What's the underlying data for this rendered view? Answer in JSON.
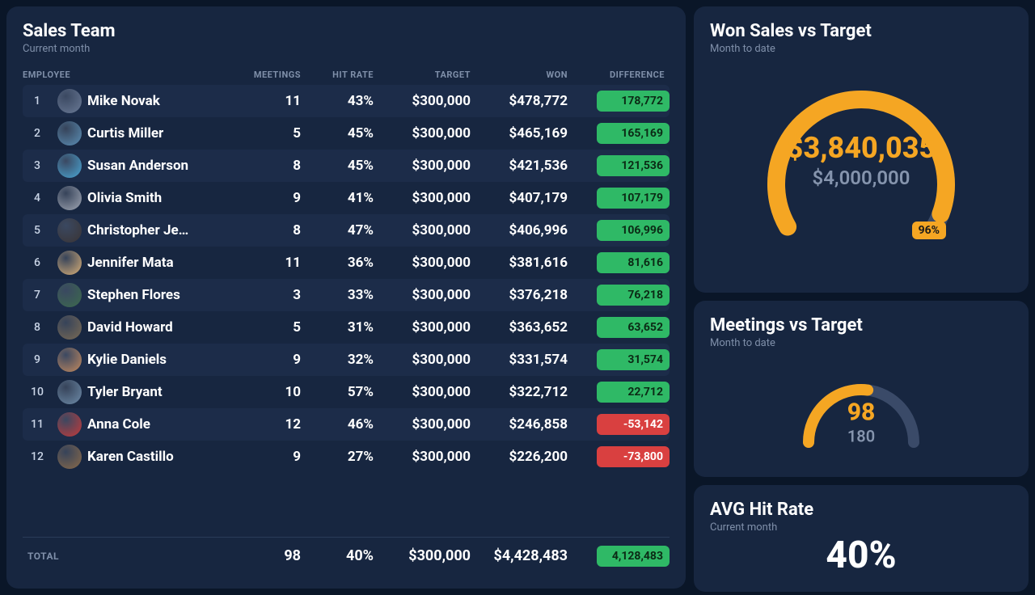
{
  "salesTeam": {
    "title": "Sales Team",
    "subtitle": "Current month",
    "columns": {
      "employee": "EMPLOYEE",
      "meetings": "MEETINGS",
      "hitrate": "HIT RATE",
      "target": "TARGET",
      "won": "WON",
      "difference": "DIFFERENCE"
    },
    "rows": [
      {
        "rank": "1",
        "name": "Mike Novak",
        "meetings": "11",
        "hitrate": "43%",
        "target": "$300,000",
        "won": "$478,772",
        "diff": "178,772",
        "diffSign": "pos"
      },
      {
        "rank": "2",
        "name": "Curtis Miller",
        "meetings": "5",
        "hitrate": "45%",
        "target": "$300,000",
        "won": "$465,169",
        "diff": "165,169",
        "diffSign": "pos"
      },
      {
        "rank": "3",
        "name": "Susan Anderson",
        "meetings": "8",
        "hitrate": "45%",
        "target": "$300,000",
        "won": "$421,536",
        "diff": "121,536",
        "diffSign": "pos"
      },
      {
        "rank": "4",
        "name": "Olivia Smith",
        "meetings": "9",
        "hitrate": "41%",
        "target": "$300,000",
        "won": "$407,179",
        "diff": "107,179",
        "diffSign": "pos"
      },
      {
        "rank": "5",
        "name": "Christopher Je…",
        "meetings": "8",
        "hitrate": "47%",
        "target": "$300,000",
        "won": "$406,996",
        "diff": "106,996",
        "diffSign": "pos"
      },
      {
        "rank": "6",
        "name": "Jennifer Mata",
        "meetings": "11",
        "hitrate": "36%",
        "target": "$300,000",
        "won": "$381,616",
        "diff": "81,616",
        "diffSign": "pos"
      },
      {
        "rank": "7",
        "name": "Stephen Flores",
        "meetings": "3",
        "hitrate": "33%",
        "target": "$300,000",
        "won": "$376,218",
        "diff": "76,218",
        "diffSign": "pos"
      },
      {
        "rank": "8",
        "name": "David Howard",
        "meetings": "5",
        "hitrate": "31%",
        "target": "$300,000",
        "won": "$363,652",
        "diff": "63,652",
        "diffSign": "pos"
      },
      {
        "rank": "9",
        "name": "Kylie Daniels",
        "meetings": "9",
        "hitrate": "32%",
        "target": "$300,000",
        "won": "$331,574",
        "diff": "31,574",
        "diffSign": "pos"
      },
      {
        "rank": "10",
        "name": "Tyler Bryant",
        "meetings": "10",
        "hitrate": "57%",
        "target": "$300,000",
        "won": "$322,712",
        "diff": "22,712",
        "diffSign": "pos"
      },
      {
        "rank": "11",
        "name": "Anna Cole",
        "meetings": "12",
        "hitrate": "46%",
        "target": "$300,000",
        "won": "$246,858",
        "diff": "-53,142",
        "diffSign": "neg"
      },
      {
        "rank": "12",
        "name": "Karen Castillo",
        "meetings": "9",
        "hitrate": "27%",
        "target": "$300,000",
        "won": "$226,200",
        "diff": "-73,800",
        "diffSign": "neg"
      }
    ],
    "total": {
      "label": "TOTAL",
      "meetings": "98",
      "hitrate": "40%",
      "target": "$300,000",
      "won": "$4,428,483",
      "diff": "4,128,483",
      "diffSign": "pos"
    }
  },
  "wonVsTarget": {
    "title": "Won Sales vs Target",
    "subtitle": "Month to date",
    "value": "$3,840,035",
    "target": "$4,000,000",
    "percentLabel": "96%",
    "percent": 96
  },
  "meetingsVsTarget": {
    "title": "Meetings vs Target",
    "subtitle": "Month to date",
    "value": "98",
    "target": "180",
    "percent": 54
  },
  "avgHitRate": {
    "title": "AVG Hit Rate",
    "subtitle": "Current month",
    "value": "40%"
  },
  "colors": {
    "accent": "#f5a623",
    "track": "#3a4a68",
    "positive": "#2fb966",
    "negative": "#d94040"
  },
  "chart_data": [
    {
      "type": "table",
      "title": "Sales Team — Current month",
      "columns": [
        "Employee",
        "Meetings",
        "Hit Rate",
        "Target",
        "Won",
        "Difference"
      ],
      "rows": [
        [
          "Mike Novak",
          11,
          "43%",
          300000,
          478772,
          178772
        ],
        [
          "Curtis Miller",
          5,
          "45%",
          300000,
          465169,
          165169
        ],
        [
          "Susan Anderson",
          8,
          "45%",
          300000,
          421536,
          121536
        ],
        [
          "Olivia Smith",
          9,
          "41%",
          300000,
          407179,
          107179
        ],
        [
          "Christopher Je…",
          8,
          "47%",
          300000,
          406996,
          106996
        ],
        [
          "Jennifer Mata",
          11,
          "36%",
          300000,
          381616,
          81616
        ],
        [
          "Stephen Flores",
          3,
          "33%",
          300000,
          376218,
          76218
        ],
        [
          "David Howard",
          5,
          "31%",
          300000,
          363652,
          63652
        ],
        [
          "Kylie Daniels",
          9,
          "32%",
          300000,
          331574,
          31574
        ],
        [
          "Tyler Bryant",
          10,
          "57%",
          300000,
          322712,
          22712
        ],
        [
          "Anna Cole",
          12,
          "46%",
          300000,
          246858,
          -53142
        ],
        [
          "Karen Castillo",
          9,
          "27%",
          300000,
          226200,
          -73800
        ]
      ],
      "totals": [
        "TOTAL",
        98,
        "40%",
        300000,
        4428483,
        4128483
      ]
    },
    {
      "type": "gauge",
      "title": "Won Sales vs Target",
      "subtitle": "Month to date",
      "value": 3840035,
      "target": 4000000,
      "percent": 96,
      "unit": "USD"
    },
    {
      "type": "gauge",
      "title": "Meetings vs Target",
      "subtitle": "Month to date",
      "value": 98,
      "target": 180,
      "percent": 54
    },
    {
      "type": "kpi",
      "title": "AVG Hit Rate",
      "subtitle": "Current month",
      "value": "40%"
    }
  ]
}
